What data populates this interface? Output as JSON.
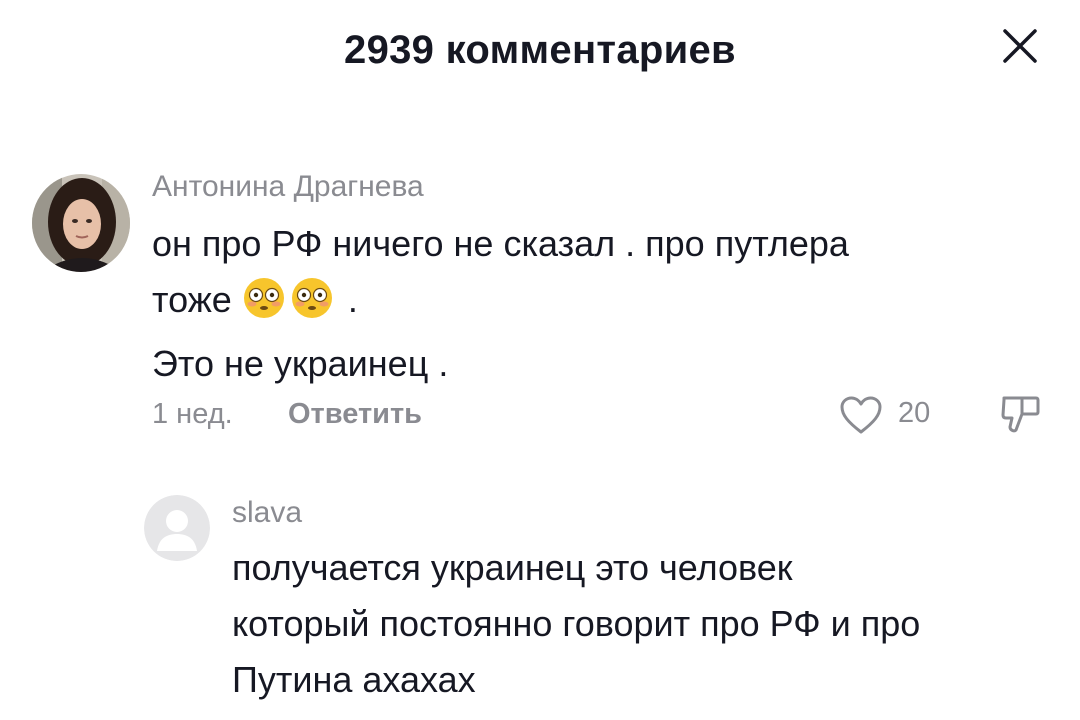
{
  "header": {
    "title": "2939 комментариев",
    "close_icon": "close-icon"
  },
  "comments": [
    {
      "author": "Антонина Драгнева",
      "text_lines": [
        "он про РФ ничего не сказал . про путлера",
        "тоже",
        " .",
        "Это не украинец ."
      ],
      "emoji": [
        "flushed-face-emoji",
        "flushed-face-emoji"
      ],
      "time": "1 нед.",
      "reply_label": "Ответить",
      "likes": "20",
      "icons": {
        "like": "heart-icon",
        "dislike": "thumbs-down-icon"
      }
    },
    {
      "author": "slava",
      "text_lines": [
        "получается украинец это человек",
        "который постоянно говорит про РФ и про",
        "Путина ахахах"
      ],
      "avatar": "default-avatar-icon"
    }
  ],
  "colors": {
    "primary_text": "#161823",
    "secondary_text": "#8a8b91",
    "emoji_face": "#f7c52c"
  }
}
